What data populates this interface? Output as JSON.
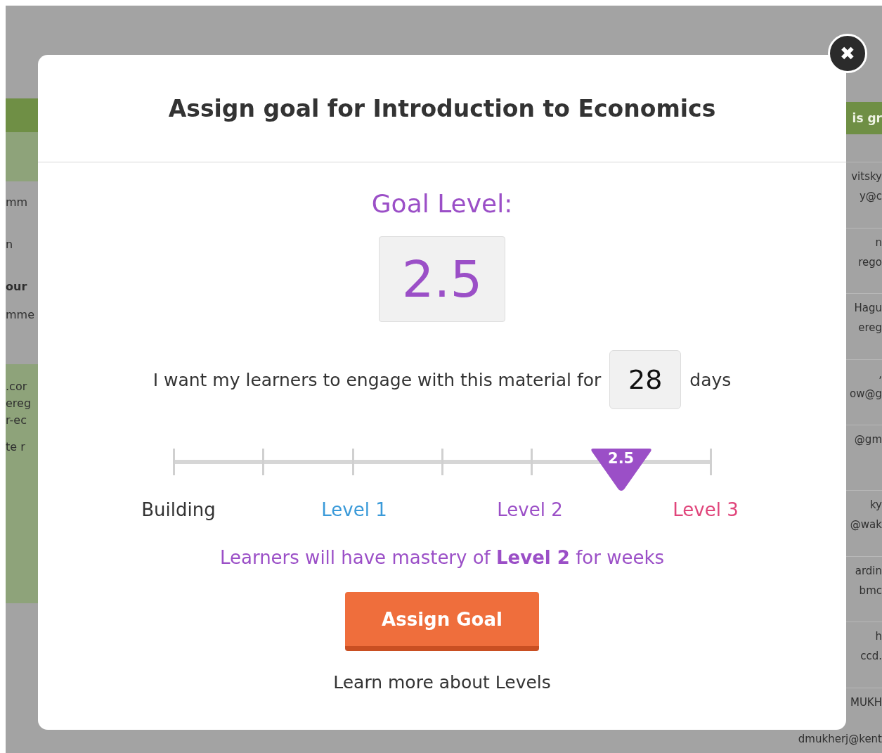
{
  "background": {
    "left_fragments": [
      "mm",
      "n",
      "our",
      "mme",
      ".cor",
      "ereg",
      "r-ec",
      "te r"
    ],
    "right_header": "is gr",
    "right_rows": [
      {
        "name": "vitsky",
        "email": "y@c"
      },
      {
        "name": "n",
        "email": "rego"
      },
      {
        "name": "Hagu",
        "email": "ereg"
      },
      {
        "name": ",",
        "email": "ow@g"
      },
      {
        "email": "@gm"
      },
      {
        "name": "ky",
        "email": "@wak"
      },
      {
        "name": "ardin",
        "email": "bmc"
      },
      {
        "name": "h",
        "email": "ccd."
      },
      {
        "name": "MUKH",
        "email": "dmukherj@kent"
      }
    ]
  },
  "dialog": {
    "title": "Assign goal for Introduction to Economics",
    "close_label": "✖",
    "goal_heading": "Goal Level:",
    "goal_value": "2.5",
    "duration": {
      "before": "I want my learners to engage with this material for",
      "value": "28",
      "after": "days"
    },
    "slider": {
      "level": 0.8333,
      "marker_label": "2.5"
    },
    "levels": [
      {
        "label": "Building",
        "color": "#333333"
      },
      {
        "label": "Level 1",
        "color": "#3a9ad9"
      },
      {
        "label": "Level 2",
        "color": "#9b4fc7"
      },
      {
        "label": "Level 3",
        "color": "#e0457b"
      }
    ],
    "mastery": "Learners will have mastery of **Level 2** for weeks",
    "assign_button": "Assign Goal",
    "learn_more": "Learn more about Levels"
  }
}
